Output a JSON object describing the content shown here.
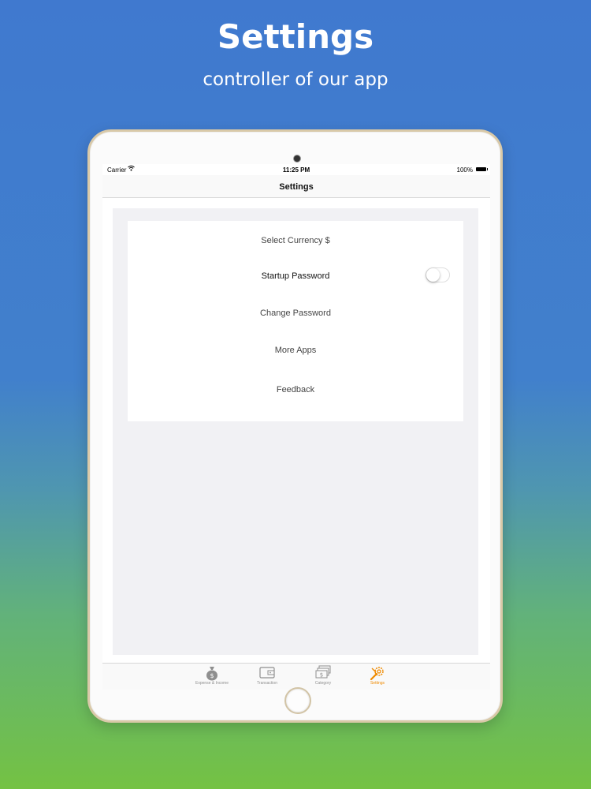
{
  "promo": {
    "title": "Settings",
    "subtitle": "controller of our app"
  },
  "status_bar": {
    "carrier": "Carrier",
    "time": "11:25 PM",
    "battery": "100%"
  },
  "nav": {
    "title": "Settings"
  },
  "settings": {
    "select_currency": "Select Currency $",
    "startup_password": "Startup Password",
    "startup_password_enabled": false,
    "change_password": "Change Password",
    "more_apps": "More Apps",
    "feedback": "Feedback"
  },
  "tab_bar": {
    "tabs": [
      {
        "label": "Expense & Income",
        "icon": "money-bag-icon",
        "active": false
      },
      {
        "label": "Transaction",
        "icon": "wallet-icon",
        "active": false
      },
      {
        "label": "Category",
        "icon": "category-stack-icon",
        "active": false
      },
      {
        "label": "Settings",
        "icon": "wrench-gear-icon",
        "active": true
      }
    ]
  },
  "colors": {
    "accent": "#ef8a00",
    "background_top": "#4079cf",
    "background_bottom": "#74c243"
  }
}
